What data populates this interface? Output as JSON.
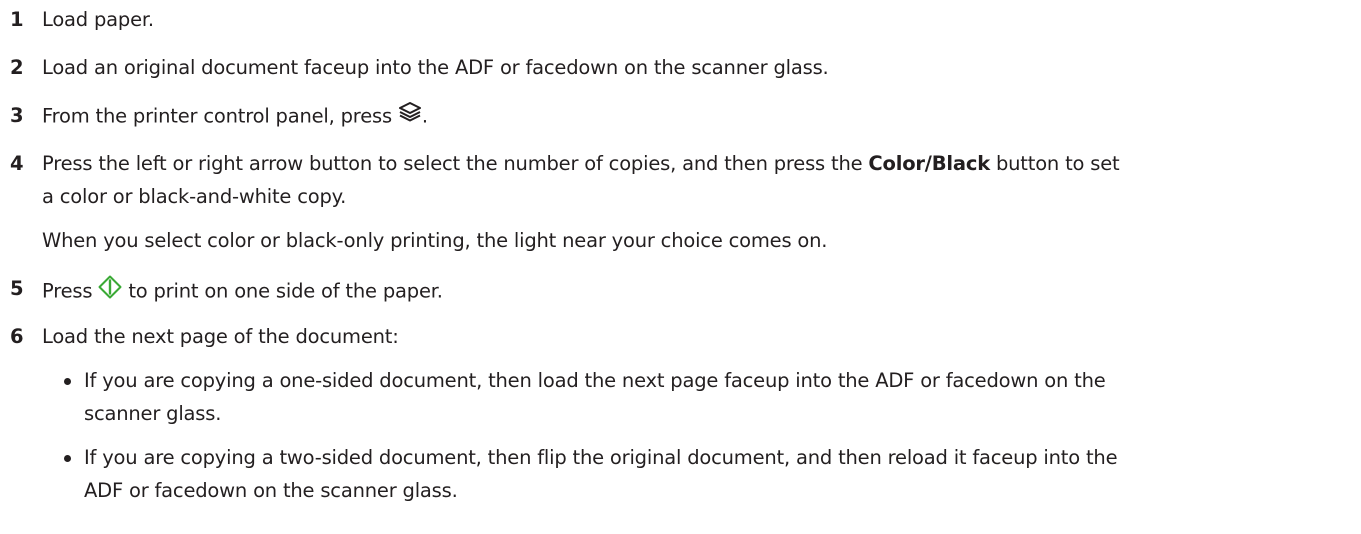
{
  "steps": [
    {
      "number": "1",
      "text": "Load paper."
    },
    {
      "number": "2",
      "text": "Load an original document faceup into the ADF or facedown on the scanner glass."
    },
    {
      "number": "3",
      "text_before": "From the printer control panel, press ",
      "icon": "copy-layers-icon",
      "text_after": "."
    },
    {
      "number": "4",
      "line1_before": "Press the left or right arrow button to select the number of copies, and then press the ",
      "line1_bold": "Color/Black",
      "line1_after": " button to set",
      "line2": "a color or black-and-white copy.",
      "note": "When you select color or black-only printing, the light near your choice comes on."
    },
    {
      "number": "5",
      "text_before": "Press ",
      "icon": "start-diamond-icon",
      "text_after": " to print on one side of the paper."
    },
    {
      "number": "6",
      "text": "Load the next page of the document:",
      "bullets": [
        {
          "line1": "If you are copying a one-sided document, then load the next page faceup into the ADF or facedown on the",
          "line2": "scanner glass."
        },
        {
          "line1": "If you are copying a two-sided document, then flip the original document, and then reload it faceup into the",
          "line2": "ADF or facedown on the scanner glass."
        }
      ]
    }
  ],
  "colors": {
    "text": "#231f20",
    "start_icon": "#3aa935"
  }
}
